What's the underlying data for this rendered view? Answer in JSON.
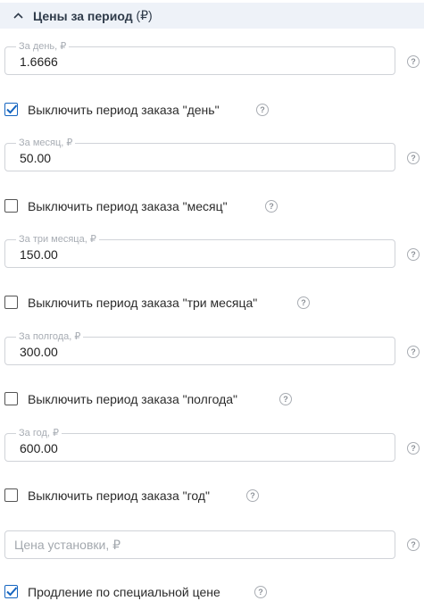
{
  "section": {
    "title": "Цены за период",
    "currency": "(₽)",
    "collapse_icon": "chevron-up-icon"
  },
  "fields": [
    {
      "label": "За день, ₽",
      "value": "1.6666"
    },
    {
      "label": "За месяц, ₽",
      "value": "50.00"
    },
    {
      "label": "За три месяца, ₽",
      "value": "150.00"
    },
    {
      "label": "За полгода, ₽",
      "value": "300.00"
    },
    {
      "label": "За год, ₽",
      "value": "600.00"
    }
  ],
  "checkboxes": [
    {
      "label": "Выключить период заказа \"день\"",
      "checked": true
    },
    {
      "label": "Выключить период заказа \"месяц\"",
      "checked": false
    },
    {
      "label": "Выключить период заказа \"три месяца\"",
      "checked": false
    },
    {
      "label": "Выключить период заказа \"полгода\"",
      "checked": false
    },
    {
      "label": "Выключить период заказа \"год\"",
      "checked": false
    },
    {
      "label": "Продление по специальной цене",
      "checked": true
    }
  ],
  "setup_field": {
    "placeholder": "Цена установки, ₽",
    "value": ""
  },
  "help_glyph": "?",
  "colors": {
    "accent": "#1565c0",
    "header_bg": "#eef2f8"
  }
}
